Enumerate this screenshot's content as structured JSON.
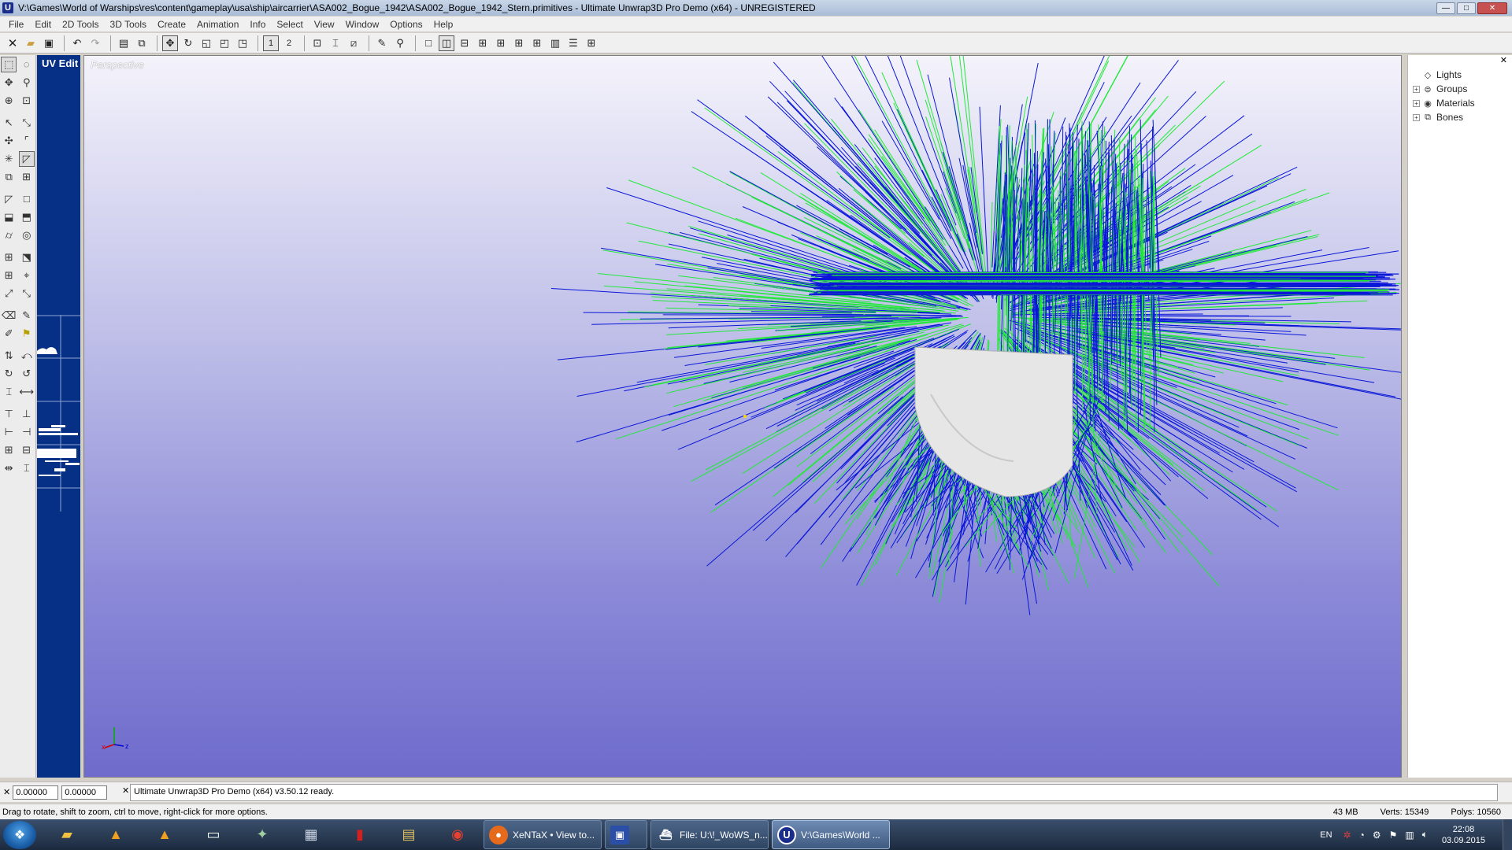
{
  "window": {
    "title": "V:\\Games\\World of Warships\\res\\content\\gameplay\\usa\\ship\\aircarrier\\ASA002_Bogue_1942\\ASA002_Bogue_1942_Stern.primitives - Ultimate Unwrap3D Pro Demo (x64) - UNREGISTERED",
    "icon_letter": "U",
    "min_label": "—",
    "max_label": "□",
    "close_label": "✕"
  },
  "menu": [
    "File",
    "Edit",
    "2D Tools",
    "3D Tools",
    "Create",
    "Animation",
    "Info",
    "Select",
    "View",
    "Window",
    "Options",
    "Help"
  ],
  "toolbar": {
    "view1_label": "1",
    "view2_label": "2"
  },
  "uv_panel": {
    "label": "UV Edit"
  },
  "viewport": {
    "label": "Perspective"
  },
  "scene_tree": {
    "close_label": "✕",
    "items": [
      {
        "label": "Lights",
        "icon": "light-icon",
        "expandable": false
      },
      {
        "label": "Groups",
        "icon": "group-icon",
        "expandable": true
      },
      {
        "label": "Materials",
        "icon": "material-icon",
        "expandable": true
      },
      {
        "label": "Bones",
        "icon": "bone-icon",
        "expandable": true
      }
    ]
  },
  "coords": {
    "x_value": "0.00000",
    "y_value": "0.00000",
    "close_label": "✕"
  },
  "log": {
    "message": "Ultimate Unwrap3D Pro Demo (x64) v3.50.12 ready."
  },
  "status": {
    "hint": "Drag to rotate, shift to zoom, ctrl to move, right-click for more options.",
    "memory": "43 MB",
    "verts": "Verts: 15349",
    "polys": "Polys: 10560"
  },
  "taskbar": {
    "tasks": [
      {
        "label": "XeNTaX • View to...",
        "icon": "firefox-icon",
        "color": "#e66a1c"
      },
      {
        "label": "",
        "icon": "floppy-icon",
        "color": "#2b4fa6"
      },
      {
        "label": "File: U:\\!_WoWS_n...",
        "icon": "ship-icon",
        "color": "#3a3a3a"
      },
      {
        "label": "V:\\Games\\World ...",
        "icon": "unwrap-icon",
        "color": "#1a2c8c"
      }
    ],
    "lang": "EN",
    "time": "22:08",
    "date": "03.09.2015"
  },
  "colors": {
    "viewport_top": "#f4f3fb",
    "viewport_bottom": "#6e6bcc",
    "uv_panel": "#062f86",
    "normal_blue": "#0a17d8",
    "normal_green": "#23e83a",
    "mesh": "#e6e6e6"
  }
}
